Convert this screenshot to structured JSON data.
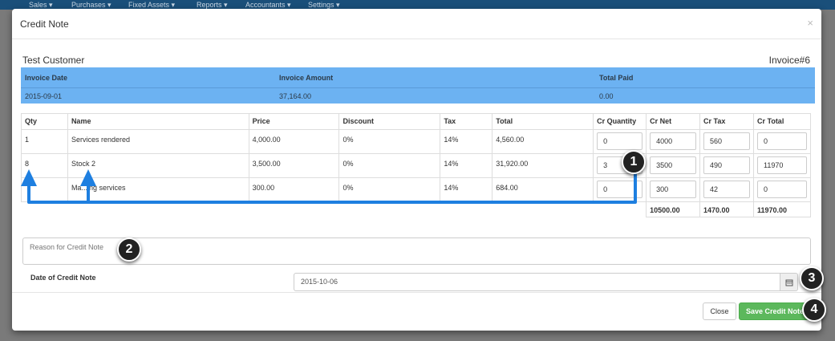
{
  "bg_nav": [
    "Sales ▾",
    "Purchases ▾",
    "Fixed Assets ▾",
    "Reports ▾",
    "Accountants ▾",
    "Settings ▾"
  ],
  "modal": {
    "title": "Credit Note",
    "close": "×"
  },
  "customer": "Test Customer",
  "invoice_number": "Invoice#6",
  "summary": {
    "headers": [
      "Invoice Date",
      "Invoice Amount",
      "Total Paid"
    ],
    "values": [
      "2015-09-01",
      "37,164.00",
      "0.00"
    ]
  },
  "table": {
    "headers": [
      "Qty",
      "Name",
      "Price",
      "Discount",
      "Tax",
      "Total",
      "Cr Quantity",
      "Cr Net",
      "Cr Tax",
      "Cr Total"
    ],
    "rows": [
      {
        "qty": "1",
        "name": "Services rendered",
        "price": "4,000.00",
        "discount": "0%",
        "tax": "14%",
        "total": "4,560.00",
        "cr_qty": "0",
        "cr_net": "4000",
        "cr_tax": "560",
        "cr_total": "0"
      },
      {
        "qty": "8",
        "name": "Stock 2",
        "price": "3,500.00",
        "discount": "0%",
        "tax": "14%",
        "total": "31,920.00",
        "cr_qty": "3",
        "cr_net": "3500",
        "cr_tax": "490",
        "cr_total": "11970"
      },
      {
        "qty": "",
        "name": "Ma...ing services",
        "price": "300.00",
        "discount": "0%",
        "tax": "14%",
        "total": "684.00",
        "cr_qty": "0",
        "cr_net": "300",
        "cr_tax": "42",
        "cr_total": "0"
      }
    ],
    "totals": {
      "cr_net": "10500.00",
      "cr_tax": "1470.00",
      "cr_total": "11970.00"
    }
  },
  "reason": {
    "placeholder": "Reason for Credit Note"
  },
  "date": {
    "label": "Date of Credit Note",
    "value": "2015-10-06",
    "icon": "calendar-icon"
  },
  "buttons": {
    "close": "Close",
    "save": "Save Credit Note"
  },
  "callouts": [
    "1",
    "2",
    "3",
    "4"
  ],
  "colors": {
    "summary_bg": "#6cb2f2",
    "save_btn": "#5cb85c",
    "arrow": "#1e7fe0",
    "nav_bg": "#1a4f7a"
  }
}
